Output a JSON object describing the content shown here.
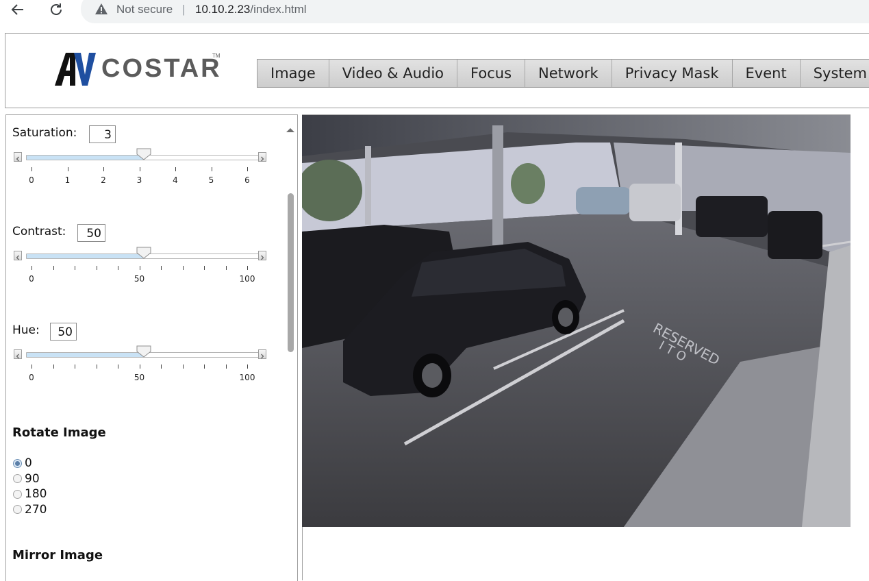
{
  "browser": {
    "security_label": "Not secure",
    "separator": "|",
    "url_host": "10.10.2.23",
    "url_path": "/index.html"
  },
  "brand": {
    "logo_mark": "AV",
    "logo_text": "COSTAR",
    "logo_tm": "TM",
    "colors": {
      "av_black": "#111111",
      "av_blue": "#1f4fa0",
      "text_gray": "#5b5b5b"
    }
  },
  "tabs": [
    "Image",
    "Video & Audio",
    "Focus",
    "Network",
    "Privacy Mask",
    "Event",
    "System"
  ],
  "settings": {
    "saturation": {
      "label": "Saturation:",
      "value": "3",
      "min": 0,
      "max": 6,
      "level": 3,
      "tick_labels": [
        "0",
        "1",
        "2",
        "3",
        "4",
        "5",
        "6"
      ]
    },
    "contrast": {
      "label": "Contrast:",
      "value": "50",
      "min": 0,
      "max": 100,
      "level": 50,
      "tick_labels": [
        "0",
        "50",
        "100"
      ]
    },
    "hue": {
      "label": "Hue:",
      "value": "50",
      "min": 0,
      "max": 100,
      "level": 50,
      "tick_labels": [
        "0",
        "50",
        "100"
      ]
    },
    "rotate": {
      "title": "Rotate Image",
      "options": [
        "0",
        "90",
        "180",
        "270"
      ],
      "selected": "0"
    },
    "mirror": {
      "title": "Mirror Image"
    }
  },
  "camera": {
    "stencil_text_1": "RESERVED",
    "stencil_text_2": "I T O"
  }
}
